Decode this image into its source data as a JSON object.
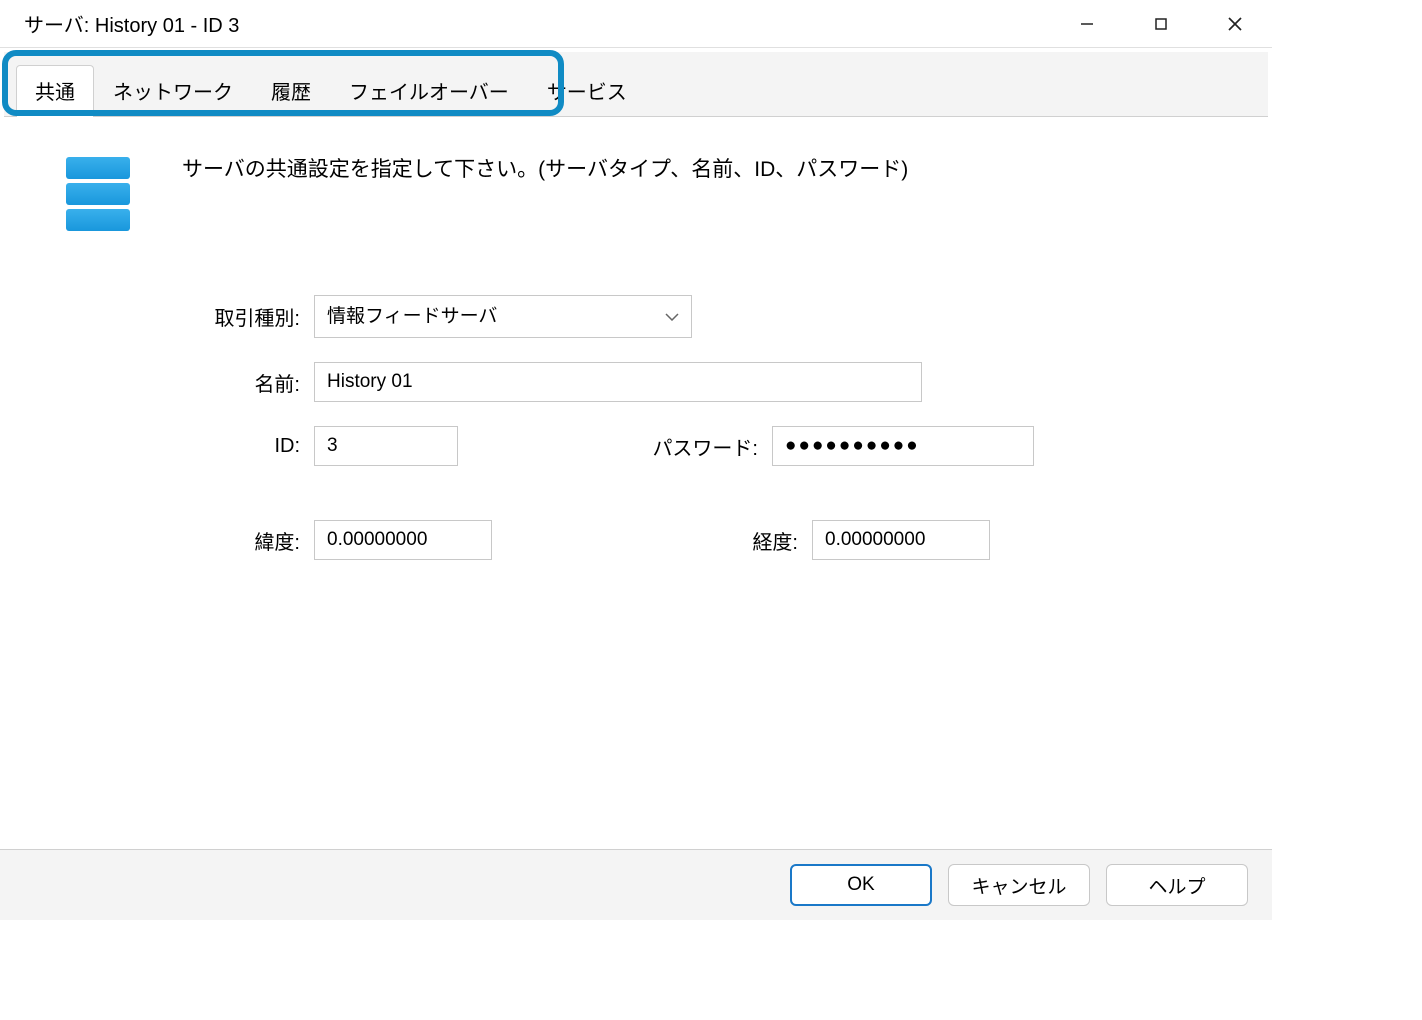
{
  "window": {
    "title": "サーバ: History 01 - ID  3"
  },
  "tabs": {
    "t0": "共通",
    "t1": "ネットワーク",
    "t2": "履歴",
    "t3": "フェイルオーバー",
    "t4": "サービス"
  },
  "content": {
    "description": "サーバの共通設定を指定して下さい。(サーバタイプ、名前、ID、パスワード)",
    "labels": {
      "type": "取引種別:",
      "name": "名前:",
      "id": "ID:",
      "password": "パスワード:",
      "lat": "緯度:",
      "lon": "経度:"
    },
    "values": {
      "type": "情報フィードサーバ",
      "name": "History 01",
      "id": "3",
      "password": "●●●●●●●●●●",
      "lat": "0.00000000",
      "lon": "0.00000000"
    }
  },
  "footer": {
    "ok": "OK",
    "cancel": "キャンセル",
    "help": "ヘルプ"
  }
}
